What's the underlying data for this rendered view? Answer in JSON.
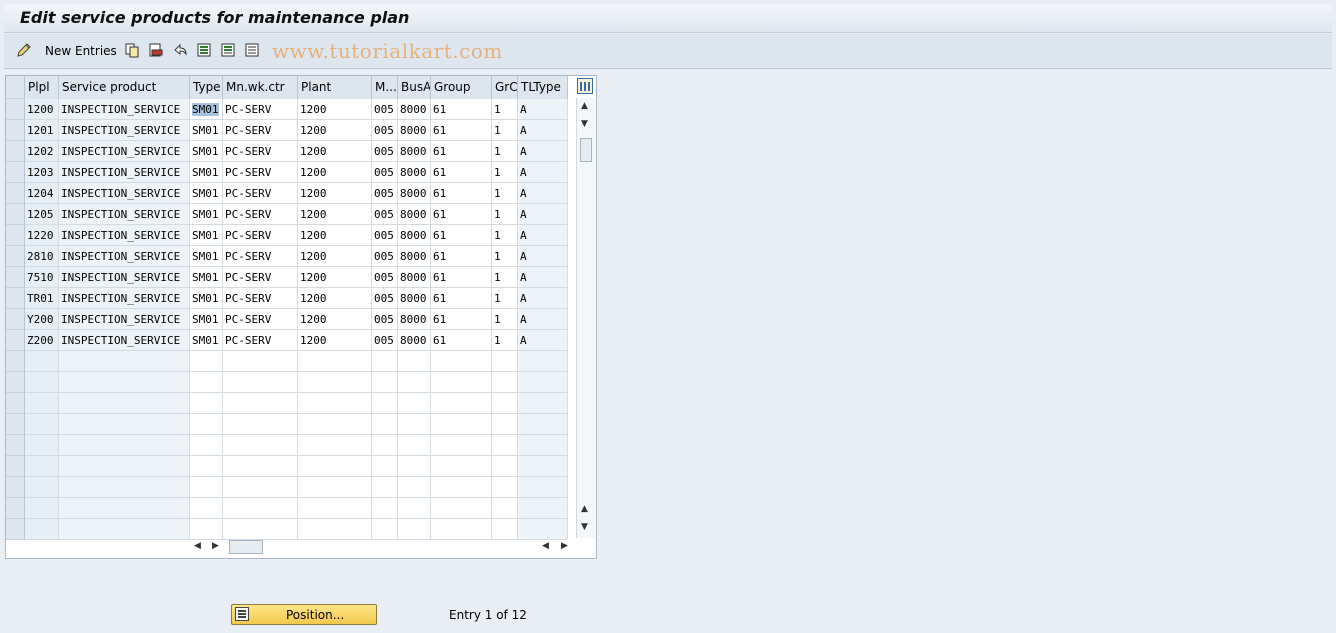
{
  "title": "Edit service products for maintenance plan",
  "toolbar": {
    "new_entries_label": "New Entries",
    "watermark": "www.tutorialkart.com",
    "icons": [
      "edit-pencil-icon",
      "copy-icon",
      "delete-icon",
      "undo-icon",
      "select-all-icon",
      "select-block-icon",
      "deselect-all-icon"
    ]
  },
  "table": {
    "columns": [
      "Plpl",
      "Service product",
      "Type",
      "Mn.wk.ctr",
      "Plant",
      "M...",
      "BusA",
      "Group",
      "GrC",
      "TLType"
    ],
    "rows": [
      [
        "1200",
        "INSPECTION_SERVICE",
        "SM01",
        "PC-SERV",
        "1200",
        "005",
        "8000",
        "61",
        "1",
        "A"
      ],
      [
        "1201",
        "INSPECTION_SERVICE",
        "SM01",
        "PC-SERV",
        "1200",
        "005",
        "8000",
        "61",
        "1",
        "A"
      ],
      [
        "1202",
        "INSPECTION_SERVICE",
        "SM01",
        "PC-SERV",
        "1200",
        "005",
        "8000",
        "61",
        "1",
        "A"
      ],
      [
        "1203",
        "INSPECTION_SERVICE",
        "SM01",
        "PC-SERV",
        "1200",
        "005",
        "8000",
        "61",
        "1",
        "A"
      ],
      [
        "1204",
        "INSPECTION_SERVICE",
        "SM01",
        "PC-SERV",
        "1200",
        "005",
        "8000",
        "61",
        "1",
        "A"
      ],
      [
        "1205",
        "INSPECTION_SERVICE",
        "SM01",
        "PC-SERV",
        "1200",
        "005",
        "8000",
        "61",
        "1",
        "A"
      ],
      [
        "1220",
        "INSPECTION_SERVICE",
        "SM01",
        "PC-SERV",
        "1200",
        "005",
        "8000",
        "61",
        "1",
        "A"
      ],
      [
        "2810",
        "INSPECTION_SERVICE",
        "SM01",
        "PC-SERV",
        "1200",
        "005",
        "8000",
        "61",
        "1",
        "A"
      ],
      [
        "7510",
        "INSPECTION_SERVICE",
        "SM01",
        "PC-SERV",
        "1200",
        "005",
        "8000",
        "61",
        "1",
        "A"
      ],
      [
        "TR01",
        "INSPECTION_SERVICE",
        "SM01",
        "PC-SERV",
        "1200",
        "005",
        "8000",
        "61",
        "1",
        "A"
      ],
      [
        "Y200",
        "INSPECTION_SERVICE",
        "SM01",
        "PC-SERV",
        "1200",
        "005",
        "8000",
        "61",
        "1",
        "A"
      ],
      [
        "Z200",
        "INSPECTION_SERVICE",
        "SM01",
        "PC-SERV",
        "1200",
        "005",
        "8000",
        "61",
        "1",
        "A"
      ]
    ],
    "empty_rows": 9,
    "selected_cell": {
      "row": 0,
      "col": 2
    }
  },
  "footer": {
    "position_label": "Position...",
    "entry_text": "Entry 1 of 12"
  }
}
